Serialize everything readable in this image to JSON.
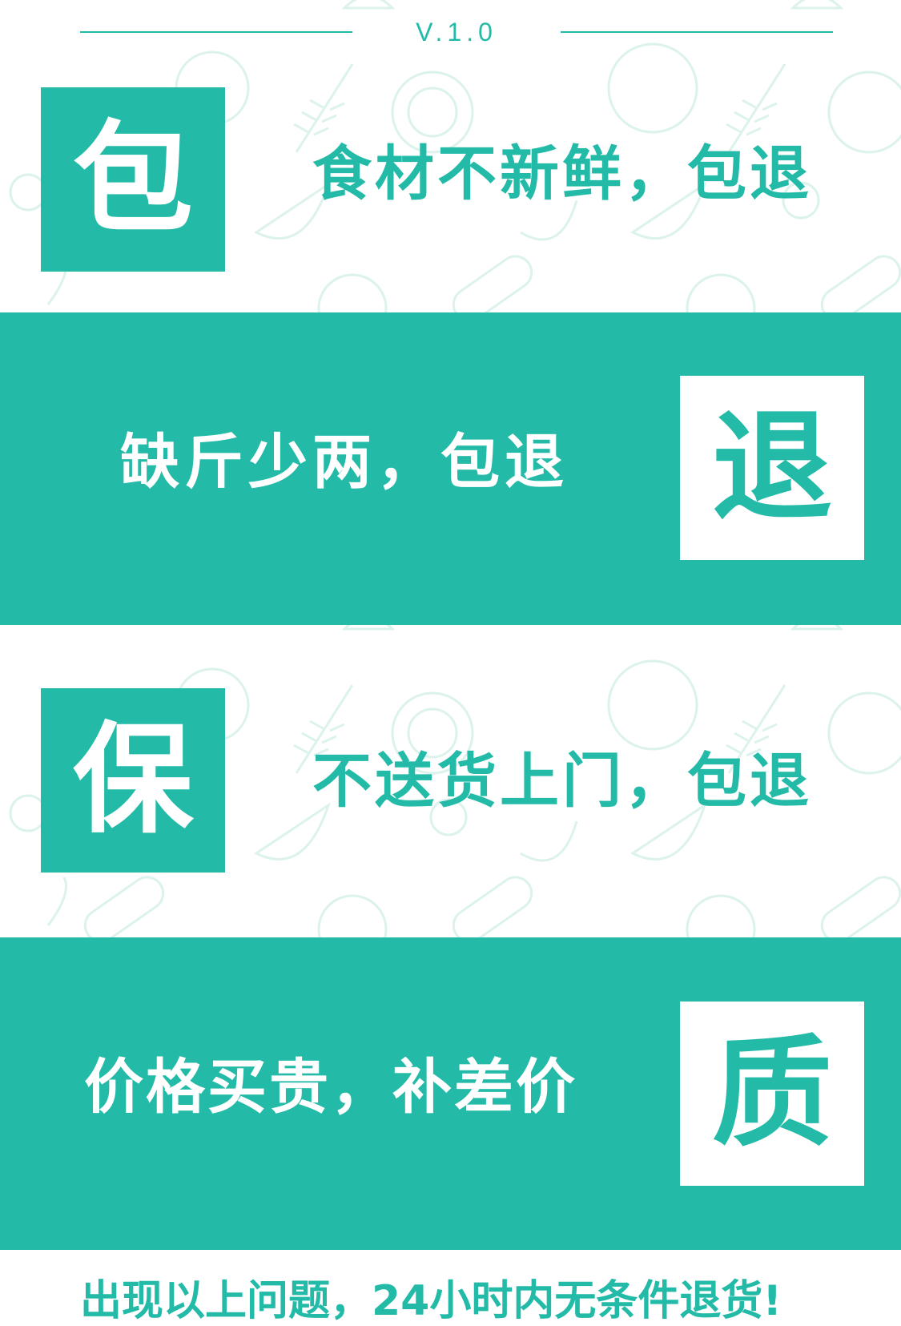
{
  "version": "V.1.0",
  "rows": [
    {
      "badge": "包",
      "text": "食材不新鲜，包退"
    },
    {
      "badge": "退",
      "text": "缺斤少两，包退"
    },
    {
      "badge": "保",
      "text": "不送货上门，包退"
    },
    {
      "badge": "质",
      "text": "价格买贵，补差价"
    }
  ],
  "footer": "出现以上问题，24小时内无条件退货!",
  "colors": {
    "accent": "#23bba8",
    "background": "#ffffff",
    "doodle": "#dff3ee"
  },
  "background_icons": [
    "tomato-icon",
    "wheat-icon",
    "lemon-icon",
    "watermelon-icon",
    "apple-icon",
    "banana-icon",
    "cucumber-icon",
    "broccoli-icon",
    "chili-icon",
    "mushroom-icon"
  ]
}
